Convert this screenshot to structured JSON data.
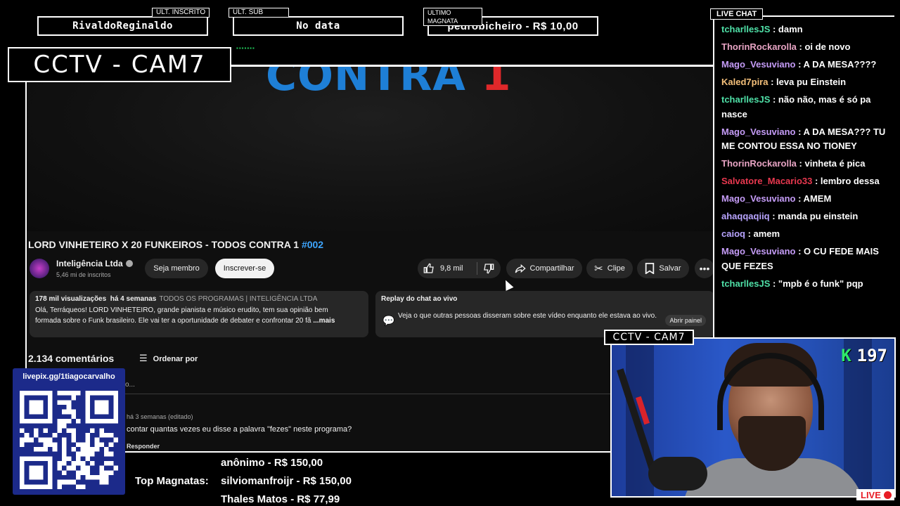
{
  "stats": {
    "ult_inscrito": {
      "tag": "ULT. INSCRITO",
      "value": "RivaldoReginaldo"
    },
    "ult_sub": {
      "tag": "ULT. SUB",
      "value": "No data"
    },
    "ultimo_magnata": {
      "tag": "ULTIMO MAGNATA",
      "value": "pedrobicheiro - R$ 10,00"
    }
  },
  "overlay": {
    "cctv_main": "CCTV - CAM7",
    "cctv_cam": "CCTV - CAM7",
    "live_label": "LIVE",
    "kill_count": "197",
    "kill_letter": "K",
    "colors": {
      "accent_green": "#2ee86a",
      "live_red": "#e81c25",
      "pix_blue": "#1c2a8a"
    }
  },
  "video": {
    "thumbnail_text_blue": "CONTRA ",
    "thumbnail_text_red": "1",
    "title": "LORD VINHETEIRO X 20 FUNKEIROS - TODOS CONTRA 1 ",
    "title_tag": "#002",
    "channel_name": "Inteligência Ltda",
    "channel_subs": "5,46 mi de inscritos",
    "member_label": "Seja membro",
    "subscribe_label": "Inscrever-se",
    "like_count": "9,8 mil",
    "share_label": "Compartilhar",
    "clip_label": "Clipe",
    "save_label": "Salvar",
    "more_label": "•••"
  },
  "description": {
    "views": "178 mil visualizações",
    "age": "há 4 semanas",
    "program": "TODOS OS PROGRAMAS | INTELIGÊNCIA LTDA",
    "text_line1": "Olá, Terráqueos! LORD VINHETEIRO, grande pianista e músico erudito, tem sua opinião bem",
    "text_line2": "formada sobre o Funk brasileiro. Ele vai ter a oportunidade de debater e confrontar 20 fã",
    "more": "...mais"
  },
  "replay": {
    "title": "Replay do chat ao vivo",
    "text": "Veja o que outras pessoas disseram sobre este vídeo enquanto ele estava ao vivo.",
    "open_label": "Abrir painel"
  },
  "comments": {
    "count": "2.134 comentários",
    "sort_label": "Ordenar por",
    "add_placeholder": "o...",
    "first_meta": "há 3 semanas (editado)",
    "first_text": "contar quantas vezes eu disse a palavra \"fezes\" neste programa?",
    "reply_label": "Responder"
  },
  "chat": {
    "tag": "LIVE CHAT",
    "messages": [
      {
        "user": "tcharllesJS",
        "color": "#4fe0a7",
        "text": " : damn"
      },
      {
        "user": "ThorinRockarolla",
        "color": "#e8a4c4",
        "text": " : oi de novo"
      },
      {
        "user": "Mago_Vesuviano",
        "color": "#c59cf7",
        "text": " : A DA MESA????"
      },
      {
        "user": "Kaled7pira",
        "color": "#f5c07a",
        "text": " : leva pu Einstein"
      },
      {
        "user": "tcharllesJS",
        "color": "#4fe0a7",
        "text": " : não não, mas é só pa nasce"
      },
      {
        "user": "Mago_Vesuviano",
        "color": "#c59cf7",
        "text": " : A DA MESA??? TU ME CONTOU ESSA NO TIONEY"
      },
      {
        "user": "ThorinRockarolla",
        "color": "#e8a4c4",
        "text": " : vinheta é pica"
      },
      {
        "user": "Salvatore_Macario33",
        "color": "#e8384f",
        "text": " : lembro dessa"
      },
      {
        "user": "Mago_Vesuviano",
        "color": "#c59cf7",
        "text": " : AMEM"
      },
      {
        "user": "ahaqqaqiiq",
        "color": "#b8a4ff",
        "text": " : manda pu einstein"
      },
      {
        "user": "caioq",
        "color": "#b8a4ff",
        "text": " : amem"
      },
      {
        "user": "Mago_Vesuviano",
        "color": "#c59cf7",
        "text": " : O CU FEDE MAIS QUE FEZES"
      },
      {
        "user": "tcharllesJS",
        "color": "#4fe0a7",
        "text": " : \"mpb é o funk\" pqp"
      }
    ]
  },
  "pix": {
    "link": "livepix.gg/1tiagocarvalho"
  },
  "magnatas": {
    "label": "Top Magnatas:",
    "entries": [
      "anônimo - R$ 150,00",
      "silviomanfroijr - R$ 150,00",
      "Thales Matos - R$ 77,99"
    ]
  }
}
